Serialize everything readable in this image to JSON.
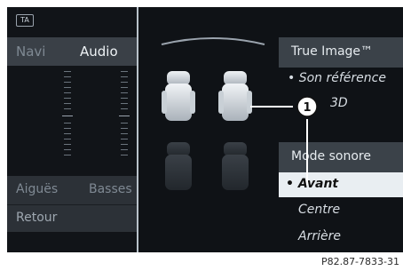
{
  "badge": "TA",
  "left_panel": {
    "tabs": [
      "Navi",
      "Audio"
    ],
    "bottom_row": [
      "Aiguës",
      "Basses"
    ],
    "back": "Retour"
  },
  "right_menu": {
    "title": "True Image™",
    "items": [
      "• Son référence",
      "3D"
    ],
    "mode_title": "Mode sonore",
    "selected": "• Avant",
    "options": [
      "Centre",
      "Arrière"
    ]
  },
  "callout": "1",
  "figure_ref": "P82.87-7833-31"
}
